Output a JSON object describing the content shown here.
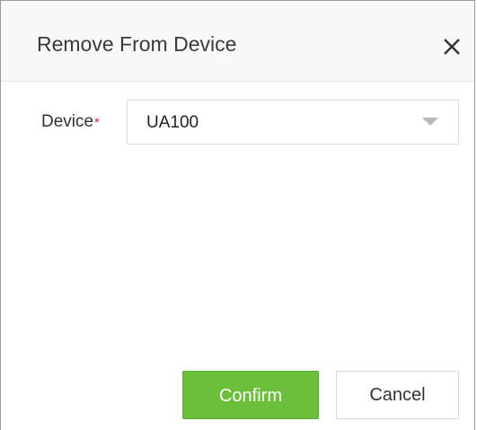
{
  "dialog": {
    "title": "Remove From Device",
    "close_icon": "close-icon"
  },
  "form": {
    "device_label": "Device",
    "required_marker": "*",
    "device_value": "UA100",
    "dropdown_icon": "chevron-down-icon"
  },
  "actions": {
    "confirm_label": "Confirm",
    "cancel_label": "Cancel"
  },
  "colors": {
    "confirm_bg": "#6cbf3a",
    "required": "#e02020",
    "header_bg": "#f8f8f8"
  }
}
